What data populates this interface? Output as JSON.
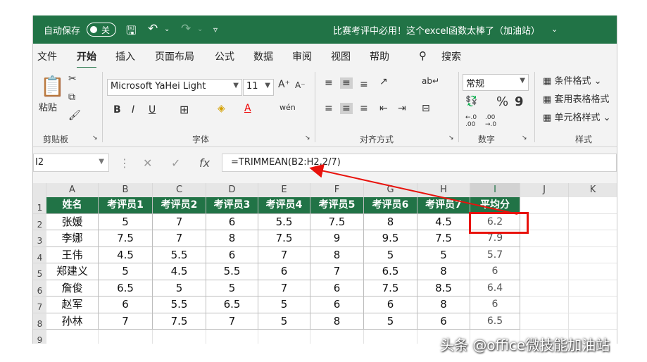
{
  "titlebar": {
    "autosave": "自动保存",
    "toggle_state": "关",
    "doc_title": "比赛考评中必用！这个excel函数太棒了（加油站）",
    "dropdown": "⌄"
  },
  "tabs": [
    "文件",
    "开始",
    "插入",
    "页面布局",
    "公式",
    "数据",
    "审阅",
    "视图",
    "帮助"
  ],
  "search_label": "搜索",
  "ribbon": {
    "paste": "粘贴",
    "clipboard_label": "剪贴板",
    "font_name": "Microsoft YaHei Light",
    "font_size": "11",
    "font_label": "字体",
    "bold": "B",
    "italic": "I",
    "underline": "U",
    "align_label": "对齐方式",
    "number_format": "常规",
    "number_label": "数字",
    "percent": "%",
    "comma": "9",
    "inc_decimal": "←.0 .00",
    "dec_decimal": ".00 →.0",
    "cond_format": "条件格式",
    "table_format": "套用表格格式",
    "cell_style": "单元格样式",
    "style_label": "样式"
  },
  "formula_bar": {
    "name_box": "I2",
    "formula": "=TRIMMEAN(B2:H2,2/7)"
  },
  "columns": [
    "A",
    "B",
    "C",
    "D",
    "E",
    "F",
    "G",
    "H",
    "I",
    "J",
    "K"
  ],
  "rows": [
    "1",
    "2",
    "3",
    "4",
    "5",
    "6",
    "7",
    "8",
    "9"
  ],
  "table": {
    "headers": [
      "姓名",
      "考评员1",
      "考评员2",
      "考评员3",
      "考评员4",
      "考评员5",
      "考评员6",
      "考评员7",
      "平均分"
    ],
    "data": [
      [
        "张媛",
        "5",
        "7",
        "6",
        "5.5",
        "7.5",
        "8",
        "4.5",
        "6.2"
      ],
      [
        "李娜",
        "7.5",
        "7",
        "8",
        "7.5",
        "9",
        "9.5",
        "7.5",
        "7.9"
      ],
      [
        "王伟",
        "4.5",
        "5.5",
        "6",
        "7",
        "8",
        "5",
        "5",
        "5.7"
      ],
      [
        "郑建义",
        "5",
        "4.5",
        "5.5",
        "6",
        "7",
        "6.5",
        "8",
        "6"
      ],
      [
        "詹俊",
        "6.5",
        "5",
        "5",
        "7",
        "6",
        "7.5",
        "8.5",
        "6.4"
      ],
      [
        "赵军",
        "6",
        "5.5",
        "6.5",
        "5",
        "6",
        "6",
        "8",
        "6"
      ],
      [
        "孙林",
        "7",
        "7.5",
        "7",
        "5",
        "8",
        "5",
        "6",
        "6.5"
      ]
    ]
  },
  "colors": {
    "accent": "#217346",
    "highlight": "#e8120c"
  },
  "watermark": "头条 @office微技能加油站"
}
